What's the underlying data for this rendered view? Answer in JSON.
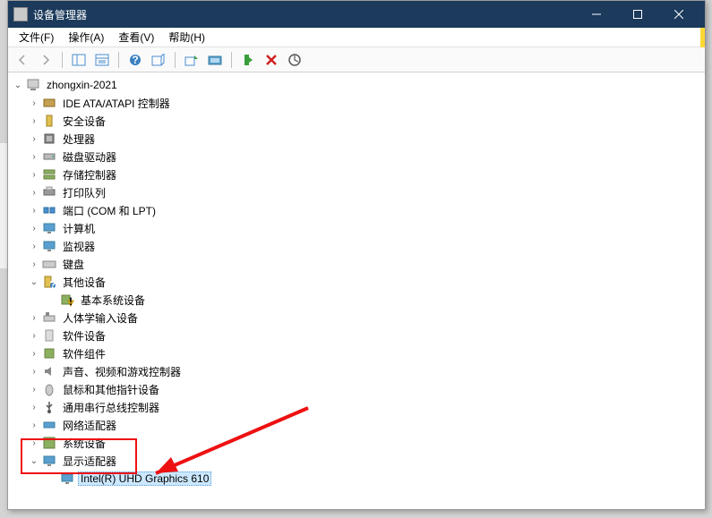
{
  "title": "设备管理器",
  "menus": {
    "file": "文件(F)",
    "action": "操作(A)",
    "view": "查看(V)",
    "help": "帮助(H)"
  },
  "root": "zhongxin-2021",
  "nodes": {
    "n0": "IDE ATA/ATAPI 控制器",
    "n1": "安全设备",
    "n2": "处理器",
    "n3": "磁盘驱动器",
    "n4": "存储控制器",
    "n5": "打印队列",
    "n6": "端口 (COM 和 LPT)",
    "n7": "计算机",
    "n8": "监视器",
    "n9": "键盘",
    "n10": "其他设备",
    "n10c": "基本系统设备",
    "n11": "人体学输入设备",
    "n12": "软件设备",
    "n13": "软件组件",
    "n14": "声音、视频和游戏控制器",
    "n15": "鼠标和其他指针设备",
    "n16": "通用串行总线控制器",
    "n17": "网络适配器",
    "n18": "系统设备",
    "n19": "显示适配器",
    "n19c": "Intel(R) UHD Graphics 610"
  }
}
